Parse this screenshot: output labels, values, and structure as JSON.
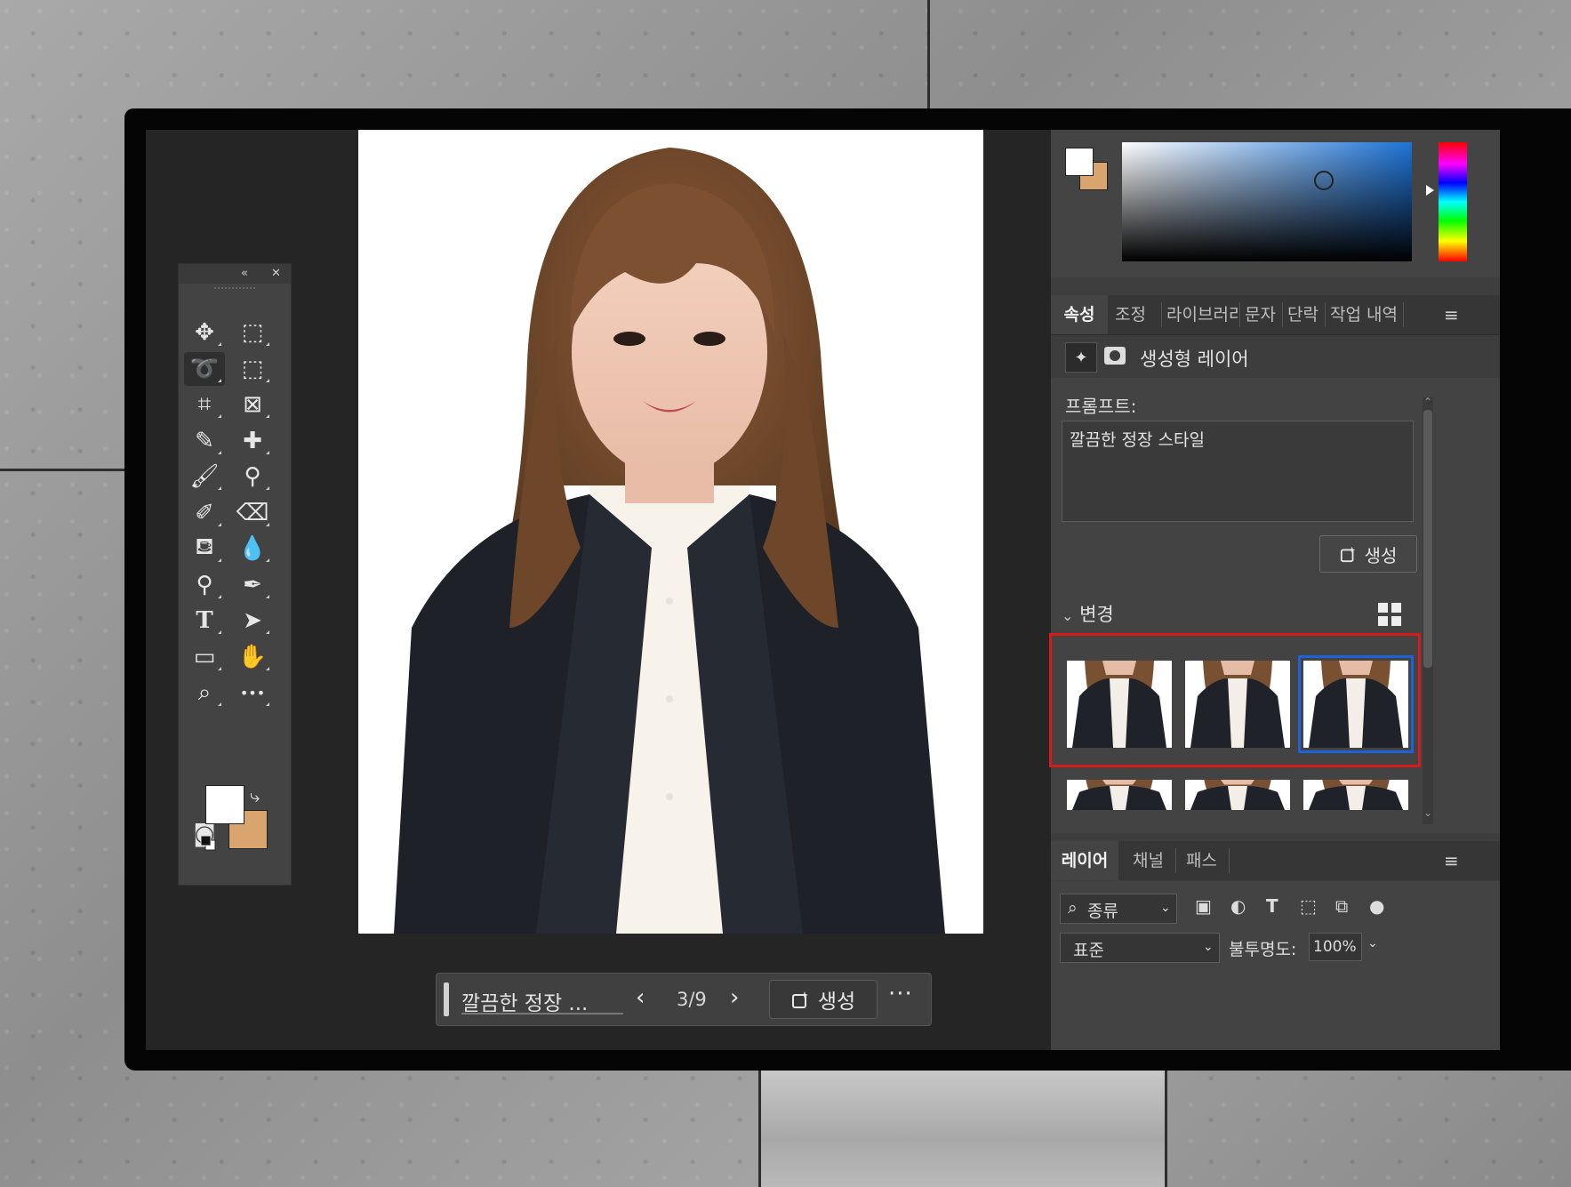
{
  "colors": {
    "foreground": "#ffffff",
    "background": "#d9a46e",
    "highlight_box": "#d81a1a",
    "selected_variation": "#1c63d9"
  },
  "toolbox": {
    "collapse_icon": "double-chevron-left-icon",
    "close_icon": "close-icon",
    "tools": [
      "move-icon",
      "marquee-icon",
      "lasso-icon",
      "object-select-icon",
      "crop-icon",
      "frame-icon",
      "eyedropper-icon",
      "healing-brush-icon",
      "brush-icon",
      "stamp-icon",
      "history-brush-icon",
      "eraser-icon",
      "paint-bucket-icon",
      "blur-icon",
      "dodge-icon",
      "pen-icon",
      "type-icon",
      "path-select-icon",
      "rectangle-icon",
      "hand-icon",
      "zoom-icon",
      "more-tools-icon",
      "quick-mask-icon",
      "screen-mode-icon"
    ]
  },
  "context_bar": {
    "prompt": "깔끔한 정장 ...",
    "counter": "3/9",
    "generate_label": "생성",
    "more": "···"
  },
  "right_panel": {
    "tabs": [
      "속성",
      "조정",
      "라이브러리",
      "문자",
      "단락",
      "작업 내역"
    ],
    "active_tab": "속성",
    "layer_type": "생성형 레이어",
    "prompt_label": "프롬프트:",
    "prompt_text": "깔끔한 정장 스타일",
    "generate_label": "생성",
    "variations_label": "변경",
    "variation_count": 6,
    "selected_variation_index": 3
  },
  "layers_panel": {
    "tabs": [
      "레이어",
      "채널",
      "패스"
    ],
    "active_tab": "레이어",
    "kind_label": "종류",
    "blend_mode": "표준",
    "opacity_label": "불투명도:",
    "opacity_value": "100%"
  }
}
